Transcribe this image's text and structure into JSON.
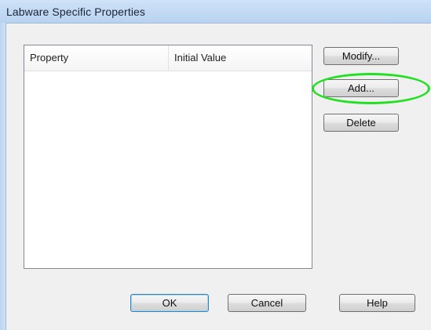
{
  "window": {
    "title": "Labware Specific Properties"
  },
  "properties_list": {
    "columns": [
      "Property",
      "Initial Value"
    ],
    "rows": []
  },
  "side_buttons": {
    "modify": "Modify...",
    "add": "Add...",
    "delete": "Delete"
  },
  "bottom_buttons": {
    "ok": "OK",
    "cancel": "Cancel",
    "help": "Help"
  },
  "annotation": {
    "highlight_color": "#22e022",
    "highlighted_control": "add-button"
  }
}
